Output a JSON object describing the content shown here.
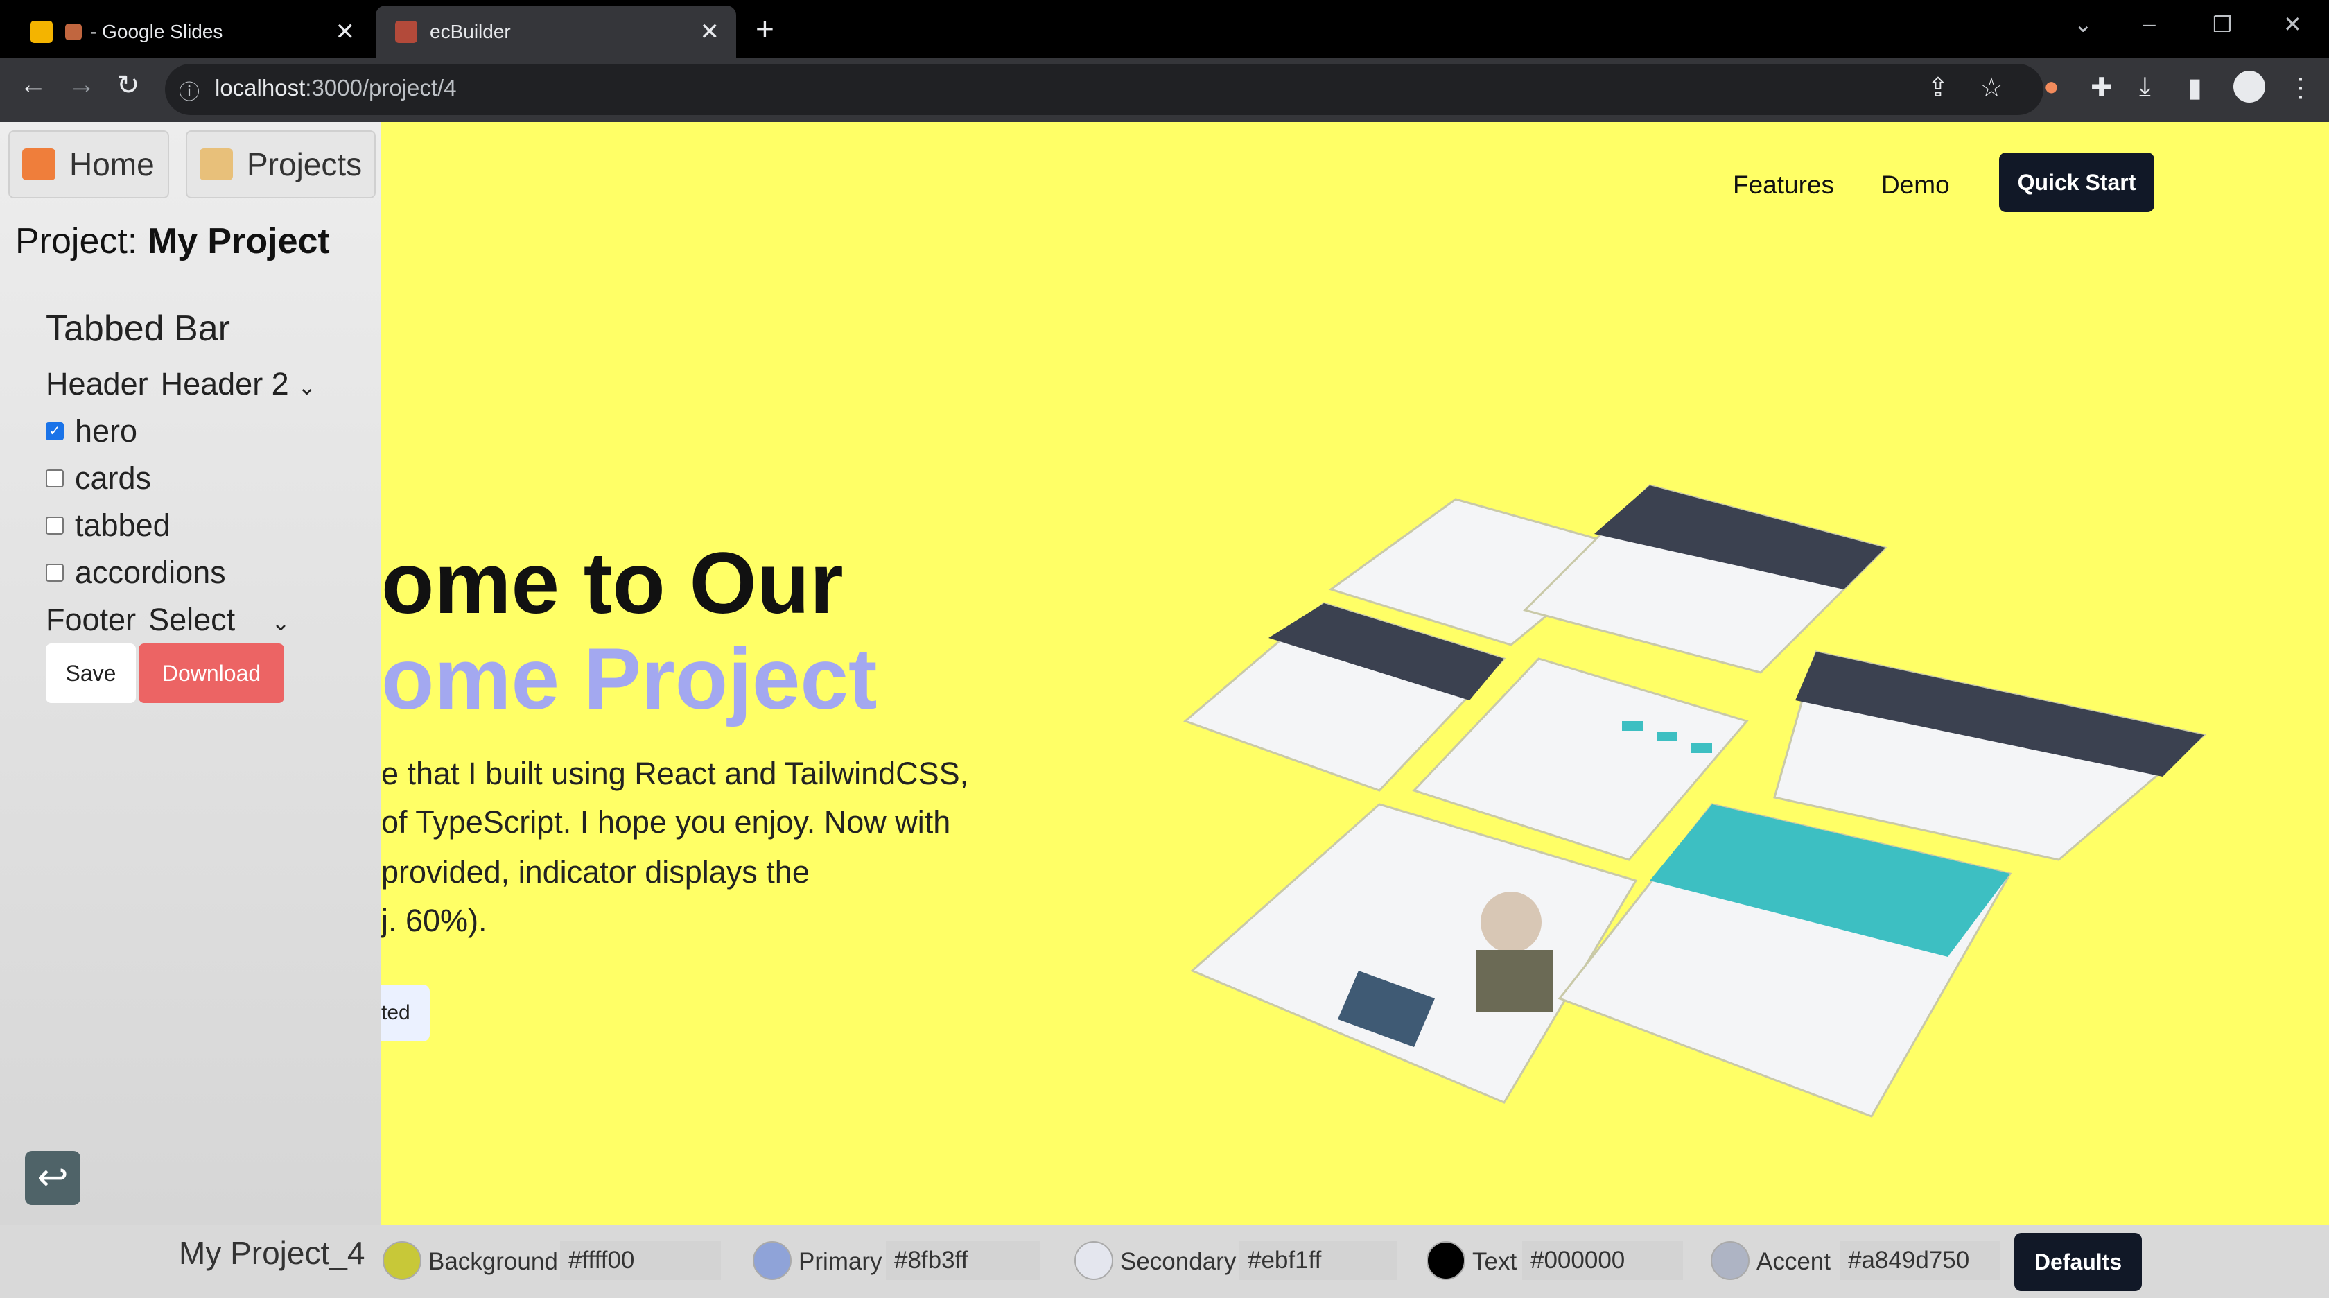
{
  "browser": {
    "tabs": [
      {
        "label": "- Google Slides"
      },
      {
        "label": "ecBuilder"
      }
    ],
    "url_host": "localhost",
    "url_path": ":3000/project/4"
  },
  "sidebar": {
    "home_label": "Home",
    "projects_label": "Projects",
    "project_prefix": "Project:",
    "project_name": "My Project",
    "section_title": "Tabbed Bar",
    "header_label": "Header",
    "header_value": "Header 2",
    "options": [
      {
        "label": "hero",
        "checked": true
      },
      {
        "label": "cards",
        "checked": false
      },
      {
        "label": "tabbed",
        "checked": false
      },
      {
        "label": "accordions",
        "checked": false
      }
    ],
    "footer_label": "Footer",
    "footer_value": "Select",
    "save_label": "Save",
    "download_label": "Download"
  },
  "main": {
    "nav": {
      "features": "Features",
      "demo": "Demo",
      "quick_start": "Quick Start"
    },
    "hero_line1": "ome to Our",
    "hero_line2": "ome Project",
    "paragraph_lines": [
      "e that I built using React and TailwindCSS,",
      "of TypeScript. I hope you enjoy. Now with",
      " provided, indicator displays the",
      "j. 60%)."
    ],
    "cta_label": "ted"
  },
  "bottom_bar": {
    "project_name": "My Project_4",
    "colors": [
      {
        "label": "Background",
        "value": "#ffff00",
        "swatch": "#c8c838"
      },
      {
        "label": "Primary",
        "value": "#8fb3ff",
        "swatch": "#8fa3d8"
      },
      {
        "label": "Secondary",
        "value": "#ebf1ff",
        "swatch": "#e4e6ee"
      },
      {
        "label": "Text",
        "value": "#000000",
        "swatch": "#000000"
      },
      {
        "label": "Accent",
        "value": "#a849d750",
        "swatch": "#aeb4c4"
      }
    ],
    "defaults_label": "Defaults"
  }
}
